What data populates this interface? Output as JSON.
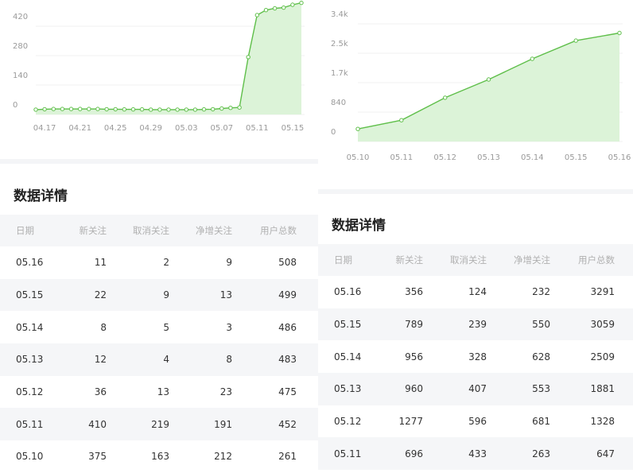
{
  "chart_data": [
    {
      "type": "area",
      "x": [
        "04.16",
        "04.17",
        "04.18",
        "04.19",
        "04.20",
        "04.21",
        "04.22",
        "04.23",
        "04.24",
        "04.25",
        "04.26",
        "04.27",
        "04.28",
        "04.29",
        "04.30",
        "05.01",
        "05.02",
        "05.03",
        "05.04",
        "05.05",
        "05.06",
        "05.07",
        "05.08",
        "05.09",
        "05.10",
        "05.11",
        "05.12",
        "05.13",
        "05.14",
        "05.15",
        "05.16"
      ],
      "values": [
        22,
        24,
        25,
        25,
        25,
        25,
        25,
        25,
        24,
        24,
        23,
        23,
        23,
        22,
        22,
        22,
        22,
        22,
        22,
        23,
        24,
        27,
        30,
        32,
        261,
        452,
        475,
        483,
        486,
        499,
        508
      ],
      "xticks": [
        "04.17",
        "04.21",
        "04.25",
        "04.29",
        "05.03",
        "05.07",
        "05.11",
        "05.15"
      ],
      "yticks": [
        "0",
        "140",
        "280",
        "420"
      ],
      "ylim": [
        0,
        510
      ],
      "color": "#5fbf4a",
      "fill": "#dcf3d8",
      "grid": true
    },
    {
      "type": "area",
      "x": [
        "05.10",
        "05.11",
        "05.12",
        "05.13",
        "05.14",
        "05.15",
        "05.16"
      ],
      "values": [
        382,
        647,
        1328,
        1881,
        2509,
        3059,
        3291
      ],
      "xticks": [
        "05.10",
        "05.11",
        "05.12",
        "05.13",
        "05.14",
        "05.15",
        "05.16"
      ],
      "yticks": [
        "0",
        "840",
        "1.7k",
        "2.5k",
        "3.4k"
      ],
      "ylim": [
        0,
        3400
      ],
      "color": "#5fbf4a",
      "fill": "#dcf3d8",
      "grid": true
    }
  ],
  "left_panel": {
    "section_title": "数据详情",
    "table": {
      "headers": [
        "日期",
        "新关注",
        "取消关注",
        "净增关注",
        "用户总数"
      ],
      "rows": [
        [
          "05.16",
          "11",
          "2",
          "9",
          "508"
        ],
        [
          "05.15",
          "22",
          "9",
          "13",
          "499"
        ],
        [
          "05.14",
          "8",
          "5",
          "3",
          "486"
        ],
        [
          "05.13",
          "12",
          "4",
          "8",
          "483"
        ],
        [
          "05.12",
          "36",
          "13",
          "23",
          "475"
        ],
        [
          "05.11",
          "410",
          "219",
          "191",
          "452"
        ],
        [
          "05.10",
          "375",
          "163",
          "212",
          "261"
        ]
      ]
    }
  },
  "right_panel": {
    "section_title": "数据详情",
    "table": {
      "headers": [
        "日期",
        "新关注",
        "取消关注",
        "净增关注",
        "用户总数"
      ],
      "rows": [
        [
          "05.16",
          "356",
          "124",
          "232",
          "3291"
        ],
        [
          "05.15",
          "789",
          "239",
          "550",
          "3059"
        ],
        [
          "05.14",
          "956",
          "328",
          "628",
          "2509"
        ],
        [
          "05.13",
          "960",
          "407",
          "553",
          "1881"
        ],
        [
          "05.12",
          "1277",
          "596",
          "681",
          "1328"
        ],
        [
          "05.11",
          "696",
          "433",
          "263",
          "647"
        ]
      ]
    }
  }
}
